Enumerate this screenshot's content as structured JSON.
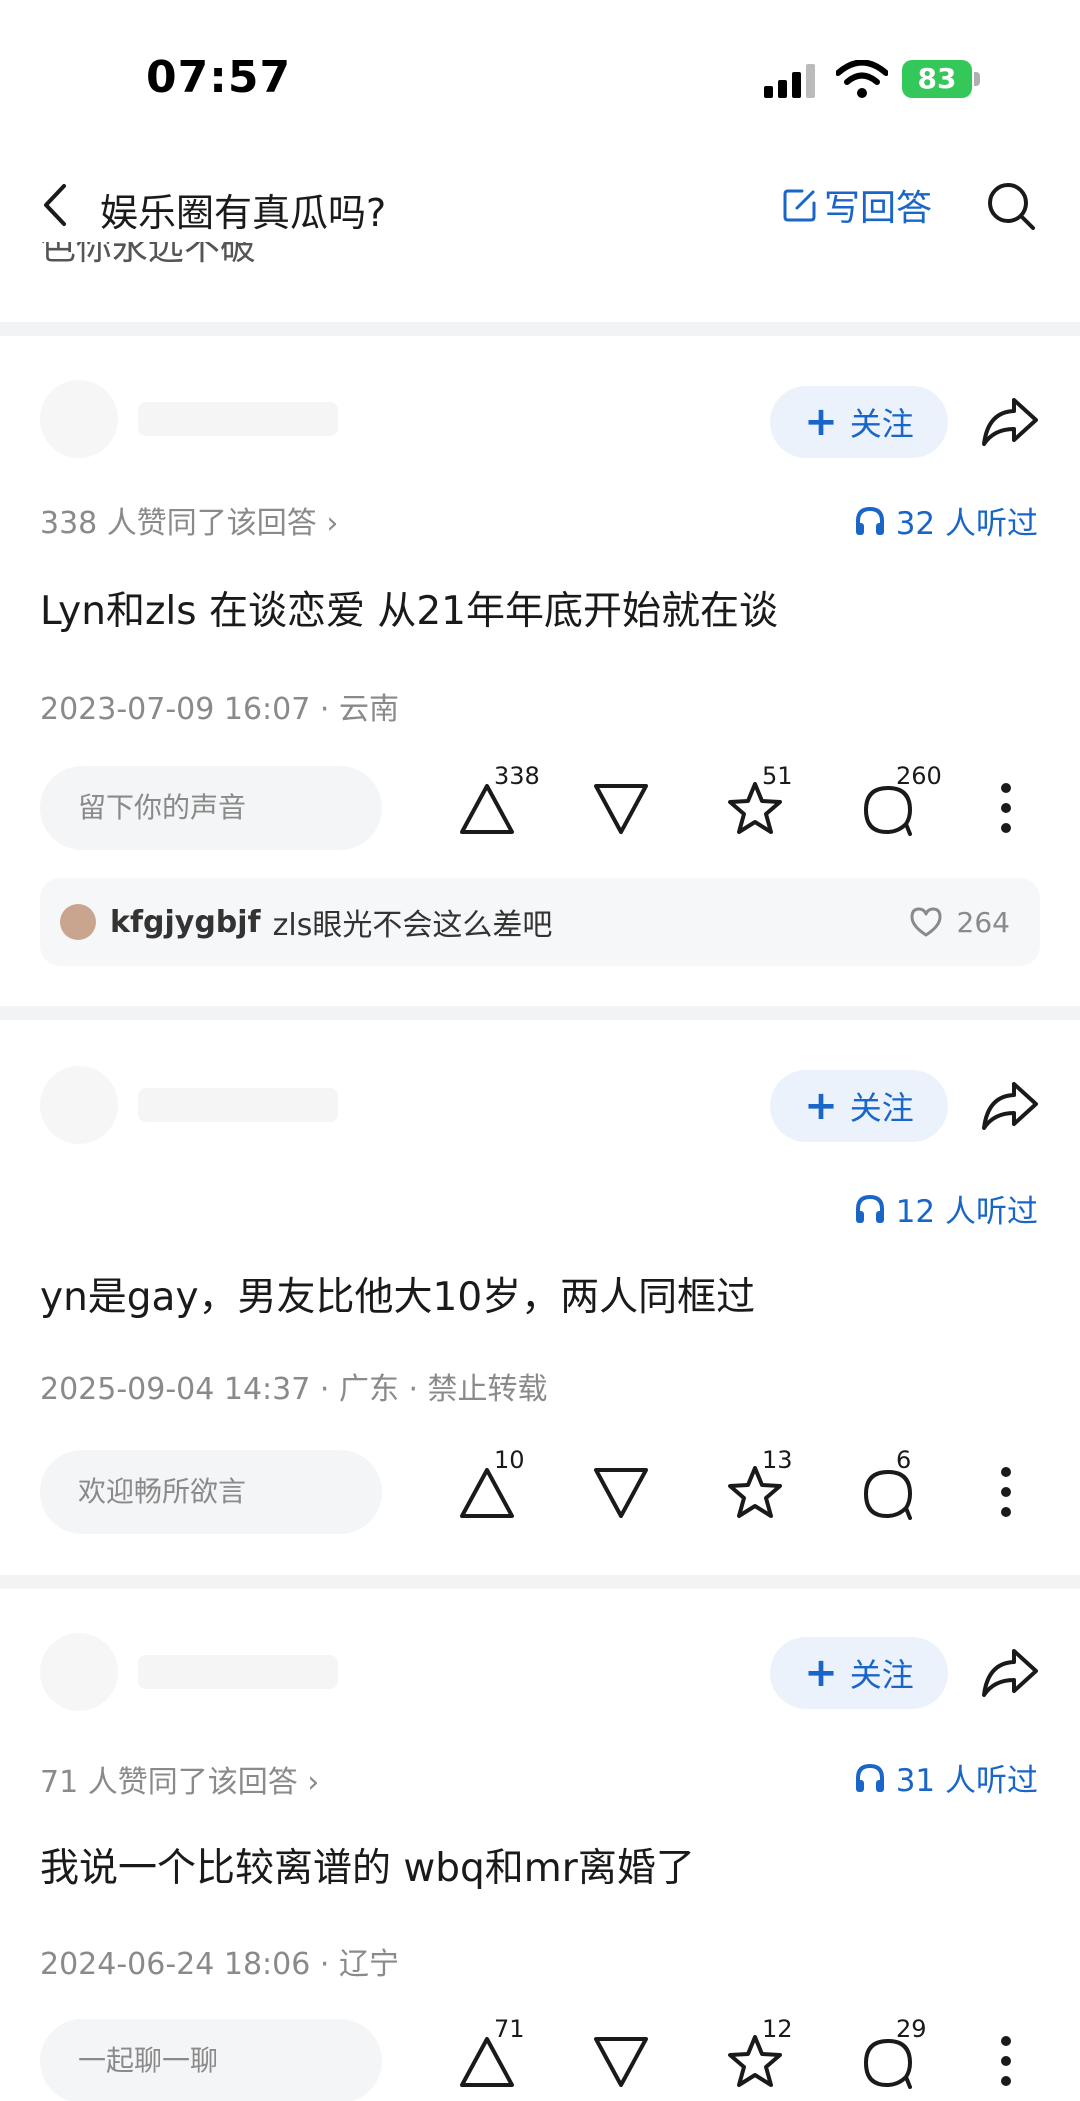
{
  "status_bar": {
    "time": "07:57",
    "battery": "83"
  },
  "nav": {
    "title": "娱乐圈有真瓜吗?",
    "write_answer": "写回答"
  },
  "partial_text": "色你永远不破",
  "follow_label": "关注",
  "answers": [
    {
      "agree_text": "338 人赞同了该回答 ›",
      "listen_text": "32 人听过",
      "content": "Lyn和zls 在谈恋爱 从21年年底开始就在谈",
      "meta": "2023-07-09 16:07 · 云南",
      "input_placeholder": "留下你的声音",
      "upvotes": "338",
      "favorites": "51",
      "comments": "260",
      "top_comment": {
        "user": "kfgjygbjf",
        "text": "zls眼光不会这么差吧",
        "likes": "264"
      }
    },
    {
      "agree_text": "",
      "listen_text": "12 人听过",
      "content": "yn是gay，男友比他大10岁，两人同框过",
      "meta": "2025-09-04 14:37 · 广东 · 禁止转载",
      "input_placeholder": "欢迎畅所欲言",
      "upvotes": "10",
      "favorites": "13",
      "comments": "6"
    },
    {
      "agree_text": "71 人赞同了该回答 ›",
      "listen_text": "31 人听过",
      "content": "我说一个比较离谱的 wbq和mr离婚了",
      "meta": "2024-06-24 18:06 · 辽宁",
      "input_placeholder": "一起聊一聊",
      "upvotes": "71",
      "favorites": "12",
      "comments": "29"
    }
  ]
}
